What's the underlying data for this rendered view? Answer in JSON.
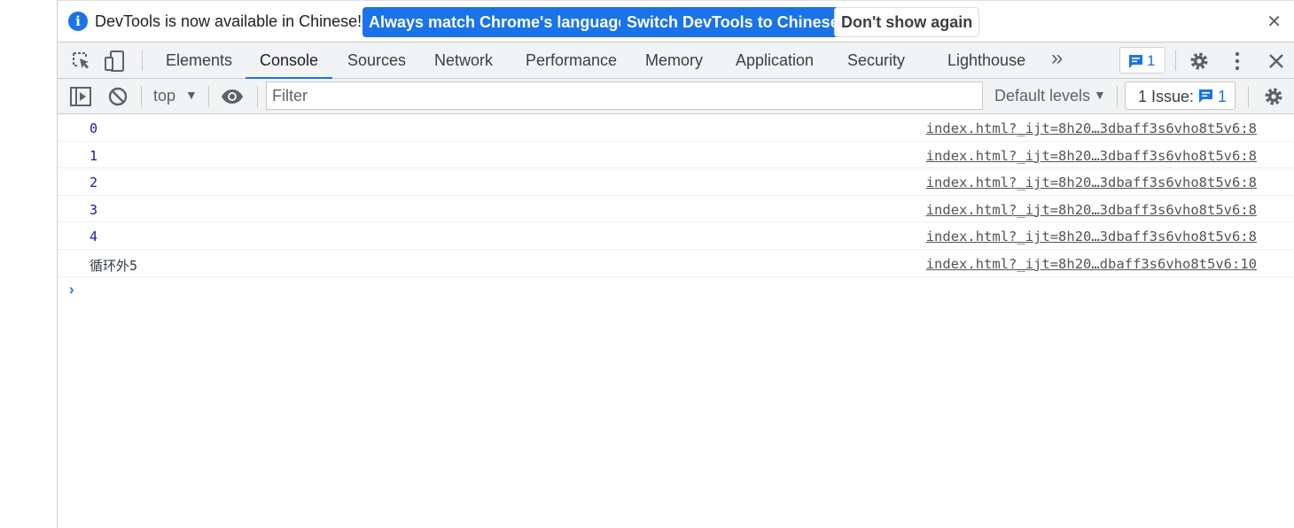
{
  "infobar": {
    "message": "DevTools is now available in Chinese!",
    "btn_match": "Always match Chrome's language",
    "btn_switch": "Switch DevTools to Chinese",
    "btn_dismiss": "Don't show again",
    "close": "✕"
  },
  "tabs": [
    {
      "label": "Elements"
    },
    {
      "label": "Console",
      "active": true
    },
    {
      "label": "Sources"
    },
    {
      "label": "Network"
    },
    {
      "label": "Performance"
    },
    {
      "label": "Memory"
    },
    {
      "label": "Application"
    },
    {
      "label": "Security"
    },
    {
      "label": "Lighthouse"
    }
  ],
  "tabbar": {
    "more": "»",
    "message_count": "1"
  },
  "console_toolbar": {
    "context": "top",
    "filter_placeholder": "Filter",
    "levels": "Default levels",
    "issues_label": "1 Issue:",
    "issues_count": "1"
  },
  "messages": [
    {
      "value": "0",
      "source": "index.html?_ijt=8h20…3dbaff3s6vho8t5v6:8"
    },
    {
      "value": "1",
      "source": "index.html?_ijt=8h20…3dbaff3s6vho8t5v6:8"
    },
    {
      "value": "2",
      "source": "index.html?_ijt=8h20…3dbaff3s6vho8t5v6:8"
    },
    {
      "value": "3",
      "source": "index.html?_ijt=8h20…3dbaff3s6vho8t5v6:8"
    },
    {
      "value": "4",
      "source": "index.html?_ijt=8h20…3dbaff3s6vho8t5v6:8"
    },
    {
      "value": "循环外5",
      "source": "index.html?_ijt=8h20…dbaff3s6vho8t5v6:10"
    }
  ],
  "prompt": "›",
  "colors": {
    "accent": "#1a73e8",
    "number": "#1a1aa6",
    "toolbar_bg": "#f1f3f4"
  }
}
